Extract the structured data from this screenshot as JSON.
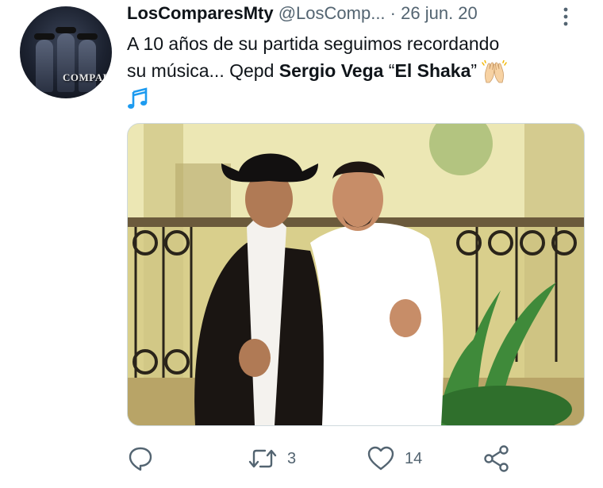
{
  "tweet": {
    "display_name": "LosComparesMty",
    "handle": "@LosComp...",
    "separator": "·",
    "date": "26 jun. 20",
    "text_line1": "A 10 años de su partida seguimos recordando",
    "text_line2_start": "su música... Qepd ",
    "text_bold_name": "Sergio Vega",
    "text_quoted_open": " “",
    "text_bold_nick": "El Shaka",
    "text_quoted_close": "” ",
    "avatar_logo": "COMPARES"
  },
  "actions": {
    "retweets": "3",
    "likes": "14"
  },
  "icons": {
    "more": "more-vertical-icon",
    "reply": "reply-icon",
    "retweet": "retweet-icon",
    "like": "heart-icon",
    "share": "share-icon",
    "emoji_hands": "raising-hands-emoji",
    "emoji_music": "musical-notes-emoji"
  },
  "colors": {
    "text": "#0f1419",
    "secondary": "#536471",
    "music_blue": "#1d9bf0"
  }
}
